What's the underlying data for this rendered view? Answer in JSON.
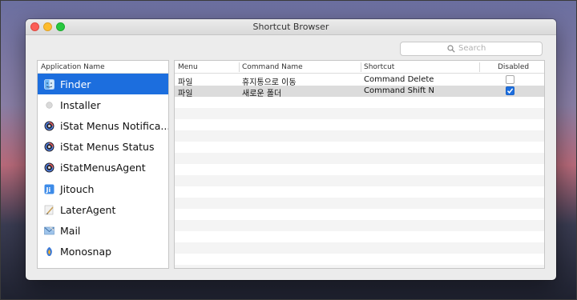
{
  "window": {
    "title": "Shortcut Browser"
  },
  "search": {
    "placeholder": "Search",
    "icon": "search-icon"
  },
  "app_list": {
    "header": "Application Name",
    "items": [
      {
        "label": "Finder",
        "icon": "finder-icon",
        "selected": true
      },
      {
        "label": "Installer",
        "icon": "installer-icon"
      },
      {
        "label": "iStat Menus Notifica...",
        "icon": "istat-icon"
      },
      {
        "label": "iStat Menus Status",
        "icon": "istat-icon"
      },
      {
        "label": "iStatMenusAgent",
        "icon": "istat-icon"
      },
      {
        "label": "Jitouch",
        "icon": "jitouch-icon"
      },
      {
        "label": "LaterAgent",
        "icon": "later-agent-icon"
      },
      {
        "label": "Mail",
        "icon": "mail-icon"
      },
      {
        "label": "Monosnap",
        "icon": "monosnap-icon"
      }
    ]
  },
  "shortcuts_table": {
    "columns": [
      "Menu",
      "Command Name",
      "Shortcut",
      "Disabled"
    ],
    "rows": [
      {
        "menu": "파일",
        "command": "휴지통으로 이동",
        "shortcut": "Command Delete",
        "disabled": false
      },
      {
        "menu": "파일",
        "command": "새로운 폴더",
        "shortcut": "Command Shift N",
        "disabled": true
      }
    ]
  },
  "colors": {
    "selection": "#1c6ede",
    "row_selected": "#dcdcdc"
  }
}
